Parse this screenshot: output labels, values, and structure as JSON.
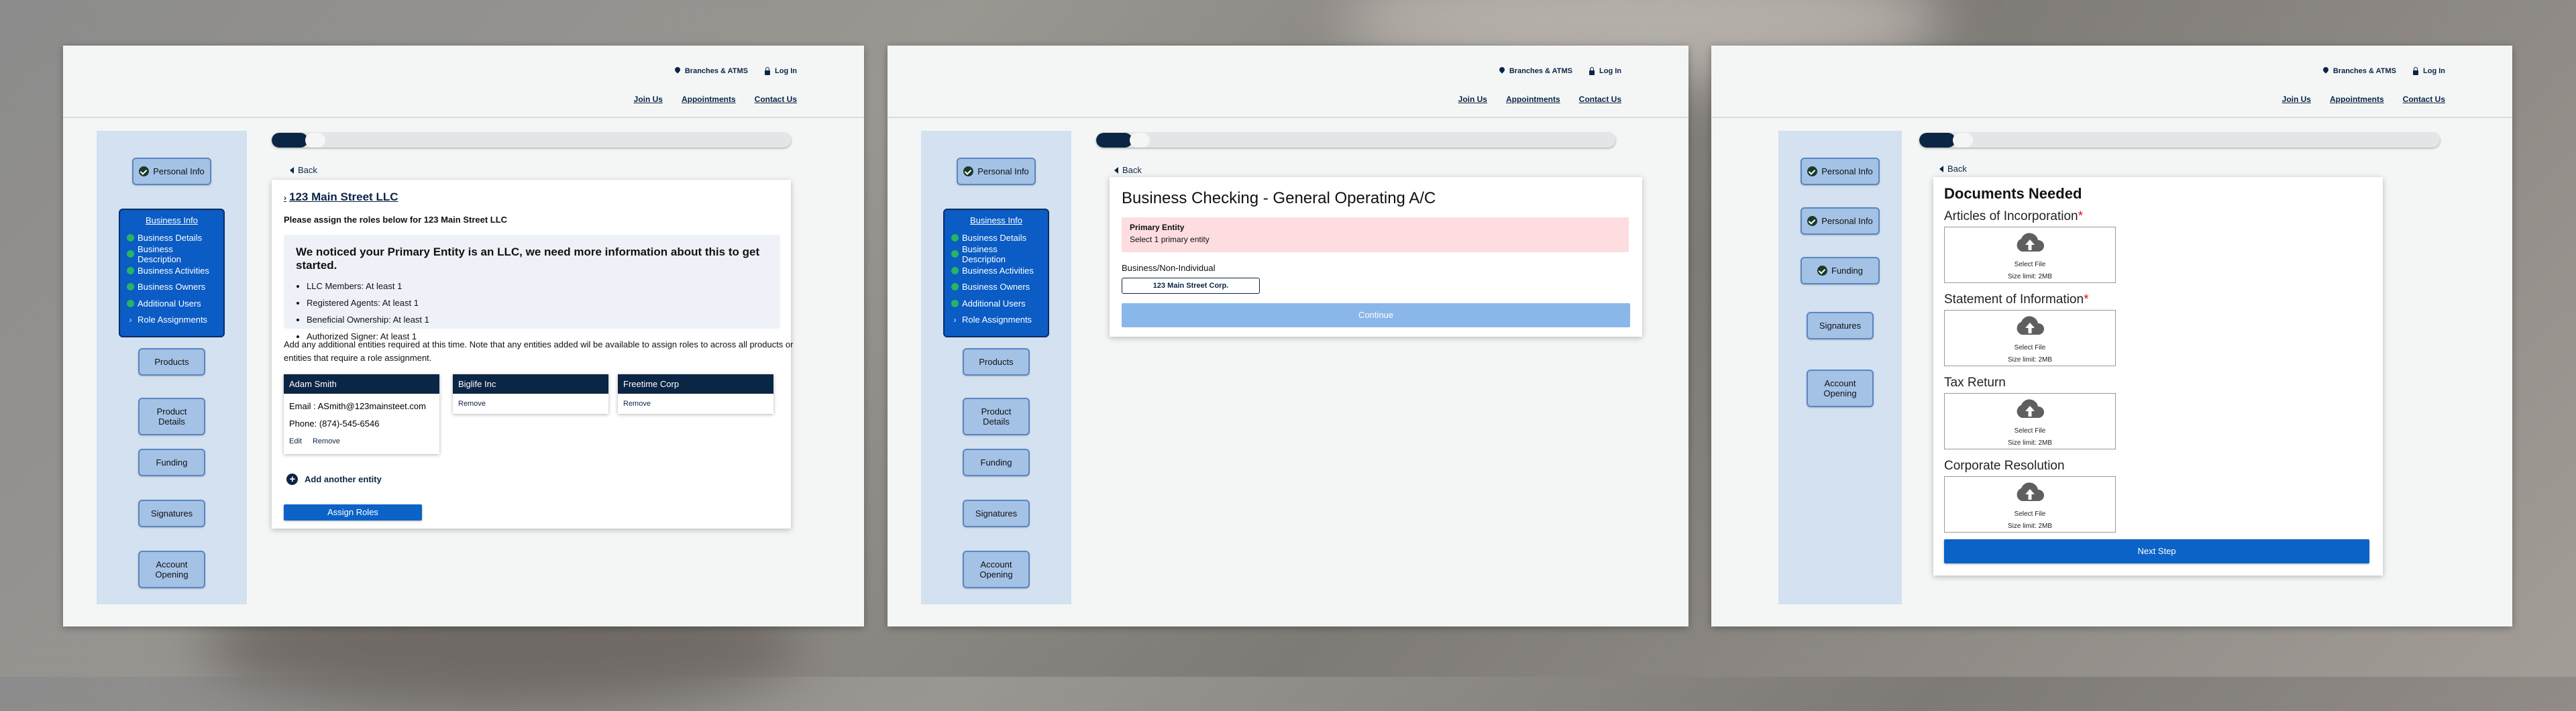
{
  "header": {
    "branches_label": "Branches & ATMS",
    "login_label": "Log In",
    "nav": [
      "Join Us",
      "Appointments",
      "Contact Us"
    ]
  },
  "sidebar": {
    "personal_info": "Personal Info",
    "business_info": "Business Info",
    "business_subitems": [
      "Business Details",
      "Business Description",
      "Business Activities",
      "Business Owners",
      "Additional Users"
    ],
    "role_assignments": "Role Assignments",
    "products": "Products",
    "product_details": "Product Details",
    "funding": "Funding",
    "signatures": "Signatures",
    "account_opening": "Account Opening"
  },
  "progress": {
    "panel1": 0.07,
    "panel2": 0.07,
    "panel3": 0.07
  },
  "back_label": "Back",
  "roles_card": {
    "title": "123 Main Street LLC",
    "subtitle": "Please assign the roles below for 123 Main Street LLC",
    "notice_heading": "We noticed your Primary Entity is an LLC, we need more information about this to get started.",
    "requirements": [
      "LLC Members: At least 1",
      "Registered Agents: At least 1",
      "Beneficial Ownership: At least 1",
      "Authorized Signer: At least 1"
    ],
    "paragraph": "Add any additional entities required at this time.  Note that any entities added wil be available to assign roles to across all products or entities that require a role assignment.",
    "entities": [
      {
        "name": "Adam Smith",
        "email": "Email : ASmith@123mainsteet.com",
        "phone": "Phone: (874)-545-6546",
        "edit": "Edit",
        "remove": "Remove"
      },
      {
        "name": "Biglife Inc",
        "remove": "Remove"
      },
      {
        "name": "Freetime Corp",
        "remove": "Remove"
      }
    ],
    "add_entity": "Add another entity",
    "assign_button": "Assign Roles"
  },
  "checking_card": {
    "title": "Business Checking - General Operating A/C",
    "alert_title": "Primary Entity",
    "alert_text": "Select 1 primary entity",
    "field_label": "Business/Non-Individual",
    "chip": "123 Main Street Corp.",
    "continue_button": "Continue"
  },
  "documents_card": {
    "title": "Documents Needed",
    "documents": [
      {
        "label": "Articles of Incorporation",
        "required": "*",
        "select": "Select File",
        "limit": "Size limit: 2MB"
      },
      {
        "label": "Statement of Information",
        "required": "*",
        "select": "Select File",
        "limit": "Size limit: 2MB"
      },
      {
        "label": "Tax Return",
        "required": "",
        "select": "Select File",
        "limit": "Size limit: 2MB"
      },
      {
        "label": "Corporate Resolution",
        "required": "",
        "select": "Select File",
        "limit": "Size limit: 2MB"
      }
    ],
    "next_button": "Next Step"
  },
  "colors": {
    "navy": "#0b2545",
    "primary_blue": "#0b63c8",
    "sidebar_bg": "#d3e1f0",
    "alert_pink": "#fddde0",
    "success_green": "#28b463"
  }
}
